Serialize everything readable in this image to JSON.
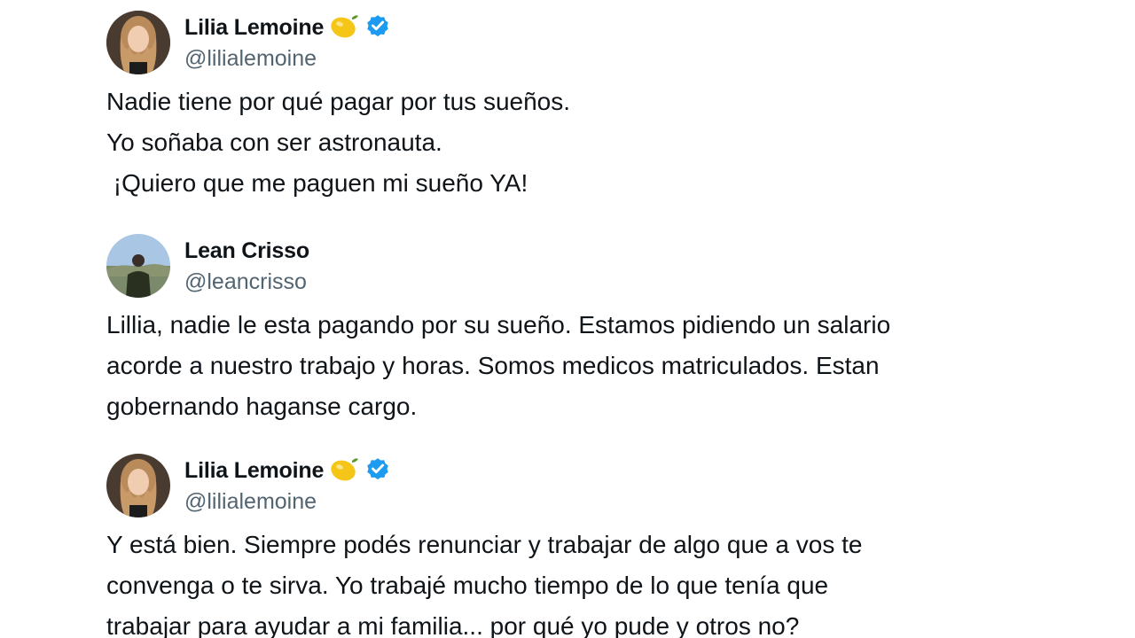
{
  "tweets": [
    {
      "display_name": "Lilia Lemoine",
      "badge_emoji_icon": "lemon-icon",
      "verified": true,
      "handle": "@lilialemoine",
      "lines": [
        "Nadie tiene por qué pagar por tus sueños.",
        "Yo soñaba con ser astronauta.",
        " ¡Quiero que me paguen mi sueño YA!"
      ]
    },
    {
      "display_name": "Lean Crisso",
      "verified": false,
      "handle": "@leancrisso",
      "lines": [
        "Lillia, nadie le esta pagando por su sueño. Estamos pidiendo un salario",
        "acorde a nuestro trabajo y horas. Somos medicos matriculados. Estan",
        "gobernando haganse cargo."
      ]
    },
    {
      "display_name": "Lilia Lemoine",
      "badge_emoji_icon": "lemon-icon",
      "verified": true,
      "handle": "@lilialemoine",
      "lines": [
        "Y está bien. Siempre podés renunciar y trabajar de algo que a vos te",
        "convenga o te sirva. Yo trabajé mucho tiempo de lo que tenía que",
        "trabajar para ayudar a mi familia... por qué yo pude y otros no?"
      ]
    }
  ],
  "colors": {
    "text": "#0f1419",
    "handle": "#536471",
    "verified": "#1d9bf0",
    "background": "#ffffff"
  }
}
